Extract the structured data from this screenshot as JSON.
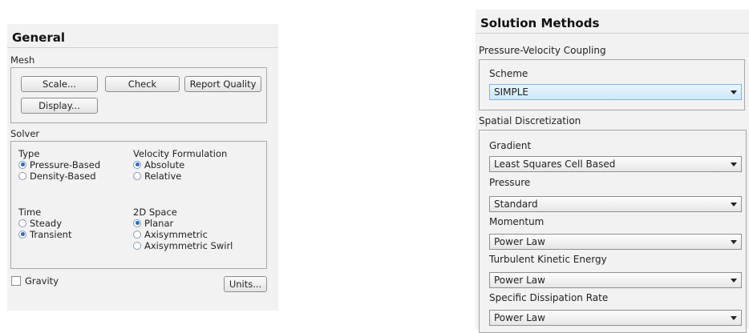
{
  "general": {
    "title": "General",
    "mesh": {
      "label": "Mesh",
      "scale_button": "Scale...",
      "check_button": "Check",
      "report_quality_button": "Report Quality",
      "display_button": "Display..."
    },
    "solver": {
      "label": "Solver",
      "type_label": "Type",
      "type_options": [
        "Pressure-Based",
        "Density-Based"
      ],
      "type_selected": "Pressure-Based",
      "velocity_label": "Velocity Formulation",
      "velocity_options": [
        "Absolute",
        "Relative"
      ],
      "velocity_selected": "Absolute",
      "time_label": "Time",
      "time_options": [
        "Steady",
        "Transient"
      ],
      "time_selected": "Transient",
      "space_label": "2D Space",
      "space_options": [
        "Planar",
        "Axisymmetric",
        "Axisymmetric Swirl"
      ],
      "space_selected": "Planar"
    },
    "gravity_label": "Gravity",
    "gravity_checked": false,
    "units_button": "Units..."
  },
  "solution_methods": {
    "title": "Solution Methods",
    "pv_coupling_label": "Pressure-Velocity Coupling",
    "scheme_label": "Scheme",
    "scheme_value": "SIMPLE",
    "spatial_label": "Spatial Discretization",
    "fields": [
      {
        "label": "Gradient",
        "value": "Least Squares Cell Based"
      },
      {
        "label": "Pressure",
        "value": "Standard"
      },
      {
        "label": "Momentum",
        "value": "Power Law"
      },
      {
        "label": "Turbulent Kinetic Energy",
        "value": "Power Law"
      },
      {
        "label": "Specific Dissipation Rate",
        "value": "Power Law"
      }
    ]
  }
}
